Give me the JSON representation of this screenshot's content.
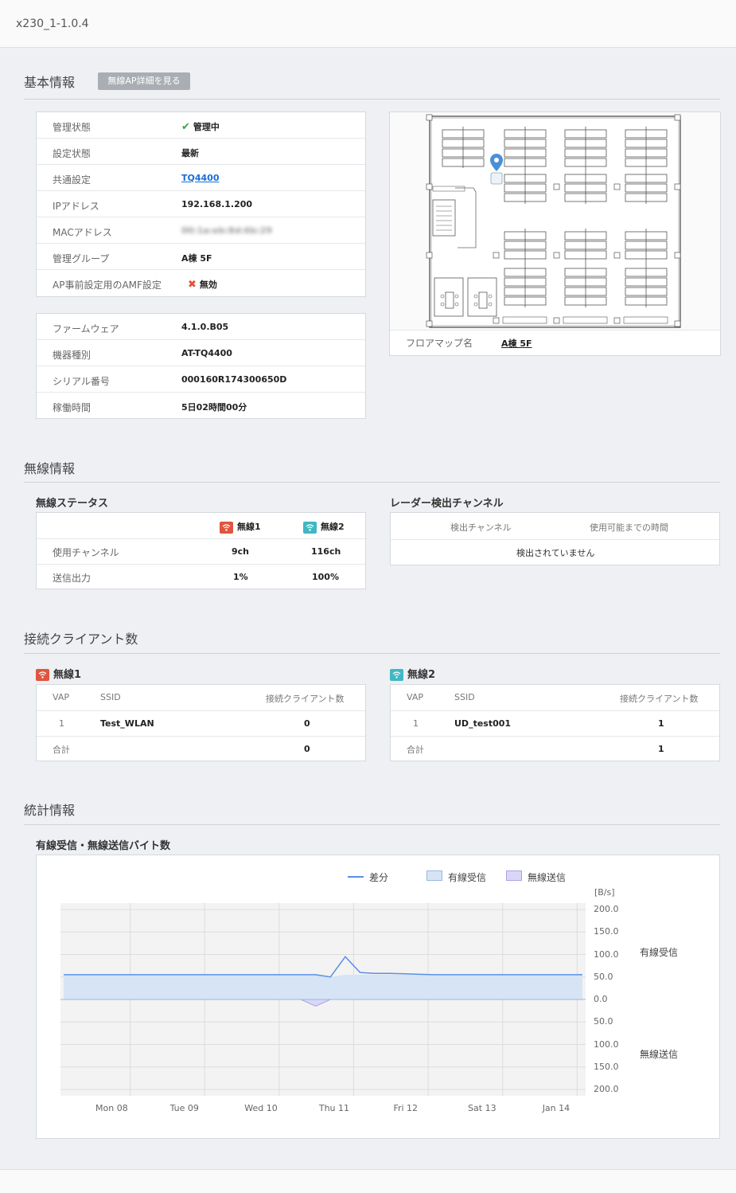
{
  "window": {
    "title": "x230_1-1.0.4"
  },
  "basic": {
    "heading": "基本情報",
    "ap_detail_button": "無線AP詳細を見る",
    "status_rows": [
      {
        "label": "管理状態",
        "value": "管理中",
        "icon": "check-icon"
      },
      {
        "label": "設定状態",
        "value": "最新"
      },
      {
        "label": "共通設定",
        "value": "TQ4400",
        "link": true
      },
      {
        "label": "IPアドレス",
        "value": "192.168.1.200"
      },
      {
        "label": "MACアドレス",
        "value": "00:1a:eb:8d:6b:29",
        "blurred": true
      },
      {
        "label": "管理グループ",
        "value": "A棟 5F"
      },
      {
        "label": "AP事前設定用のAMF設定",
        "value": "無効",
        "icon": "cross-icon"
      }
    ],
    "device_rows": [
      {
        "label": "ファームウェア",
        "value": "4.1.0.B05"
      },
      {
        "label": "機器種別",
        "value": "AT-TQ4400"
      },
      {
        "label": "シリアル番号",
        "value": "000160R174300650D"
      },
      {
        "label": "稼働時間",
        "value": "5日02時間00分"
      }
    ],
    "floor_map": {
      "label": "フロアマップ名",
      "value": "A棟 5F"
    }
  },
  "wireless": {
    "heading": "無線情報",
    "status_title": "無線ステータス",
    "radio1": "無線1",
    "radio2": "無線2",
    "rows": [
      {
        "label": "使用チャンネル",
        "r1": "9ch",
        "r2": "116ch"
      },
      {
        "label": "送信出力",
        "r1": "1%",
        "r2": "100%"
      }
    ],
    "radar_title": "レーダー検出チャンネル",
    "radar_col1": "検出チャンネル",
    "radar_col2": "使用可能までの時間",
    "radar_empty": "検出されていません"
  },
  "clients": {
    "heading": "接続クライアント数",
    "col_vap": "VAP",
    "col_ssid": "SSID",
    "col_count": "接続クライアント数",
    "total_label": "合計",
    "radio1": {
      "title": "無線1",
      "rows": [
        {
          "vap": "1",
          "ssid": "Test_WLAN",
          "count": "0"
        }
      ],
      "total": "0"
    },
    "radio2": {
      "title": "無線2",
      "rows": [
        {
          "vap": "1",
          "ssid": "UD_test001",
          "count": "1"
        }
      ],
      "total": "1"
    }
  },
  "stats": {
    "heading": "統計情報",
    "chart_title": "有線受信・無線送信バイト数",
    "colors": {
      "line": "#5b8fe6",
      "rx_fill": "#d6e4f5",
      "tx_fill": "#d9d6f7"
    }
  },
  "chart_data": {
    "type": "area",
    "legend": [
      "差分",
      "有線受信",
      "無線送信"
    ],
    "y_unit": "[B/s]",
    "y_upper_label": "有線受信",
    "y_lower_label": "無線送信",
    "y_ticks": [
      "200.0",
      "150.0",
      "100.0",
      "50.0",
      "0.0",
      "50.0",
      "100.0",
      "150.0",
      "200.0"
    ],
    "ylim": [
      -200,
      200
    ],
    "x_ticks": [
      "Mon 08",
      "Tue 09",
      "Wed 10",
      "Thu 11",
      "Fri 12",
      "Sat 13",
      "Jan 14"
    ],
    "series": [
      {
        "name": "有線受信",
        "values": [
          55,
          55,
          55,
          55,
          55,
          55,
          55,
          55,
          55,
          55,
          55,
          55,
          55,
          55,
          55,
          55,
          55,
          55,
          50,
          55,
          55,
          55,
          55,
          55,
          55,
          55,
          55,
          55,
          55,
          55,
          55,
          55,
          55,
          55,
          55,
          55
        ]
      },
      {
        "name": "差分",
        "values": [
          55,
          55,
          55,
          55,
          55,
          55,
          55,
          55,
          55,
          55,
          55,
          55,
          55,
          55,
          55,
          55,
          55,
          55,
          50,
          95,
          60,
          58,
          58,
          57,
          56,
          55,
          55,
          55,
          55,
          55,
          55,
          55,
          55,
          55,
          55,
          55
        ]
      },
      {
        "name": "無線送信",
        "values": [
          0,
          0,
          0,
          0,
          0,
          0,
          0,
          0,
          0,
          0,
          0,
          0,
          0,
          0,
          0,
          0,
          0,
          -15,
          0,
          0,
          0,
          0,
          0,
          0,
          0,
          0,
          0,
          0,
          0,
          0,
          0,
          0,
          0,
          0,
          0,
          0
        ]
      }
    ],
    "grid": true
  }
}
